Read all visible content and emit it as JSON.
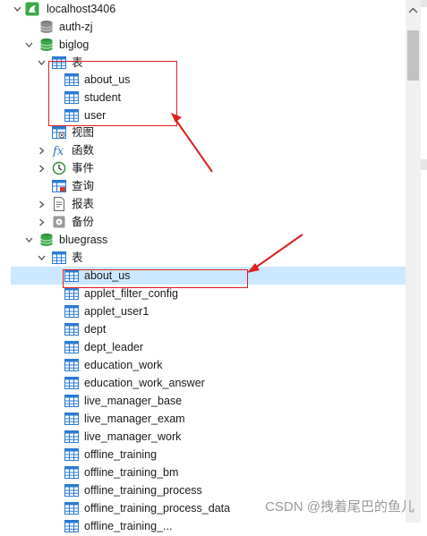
{
  "tree": {
    "connection": {
      "label": "localhost3406",
      "icon": "mysql-dolphin-icon"
    },
    "databases": [
      {
        "label": "auth-zj"
      },
      {
        "label": "biglog",
        "tables_label": "表",
        "tables": [
          "about_us",
          "student",
          "user"
        ],
        "groups": [
          "视图",
          "函数",
          "事件",
          "查询",
          "报表",
          "备份"
        ]
      },
      {
        "label": "bluegrass",
        "tables_label": "表",
        "selected_table": "about_us",
        "tables": [
          "about_us",
          "applet_filter_config",
          "applet_user1",
          "dept",
          "dept_leader",
          "education_work",
          "education_work_answer",
          "live_manager_base",
          "live_manager_exam",
          "live_manager_work",
          "offline_training",
          "offline_training_bm",
          "offline_training_process",
          "offline_training_process_data",
          "offline_training_..."
        ]
      }
    ]
  },
  "colors": {
    "db_icon": "#2e8b3d",
    "table_icon": "#2a7bd4",
    "selection": "#cce8ff",
    "annotation": "#e02020"
  },
  "watermark": "CSDN @拽着尾巴的鱼儿"
}
